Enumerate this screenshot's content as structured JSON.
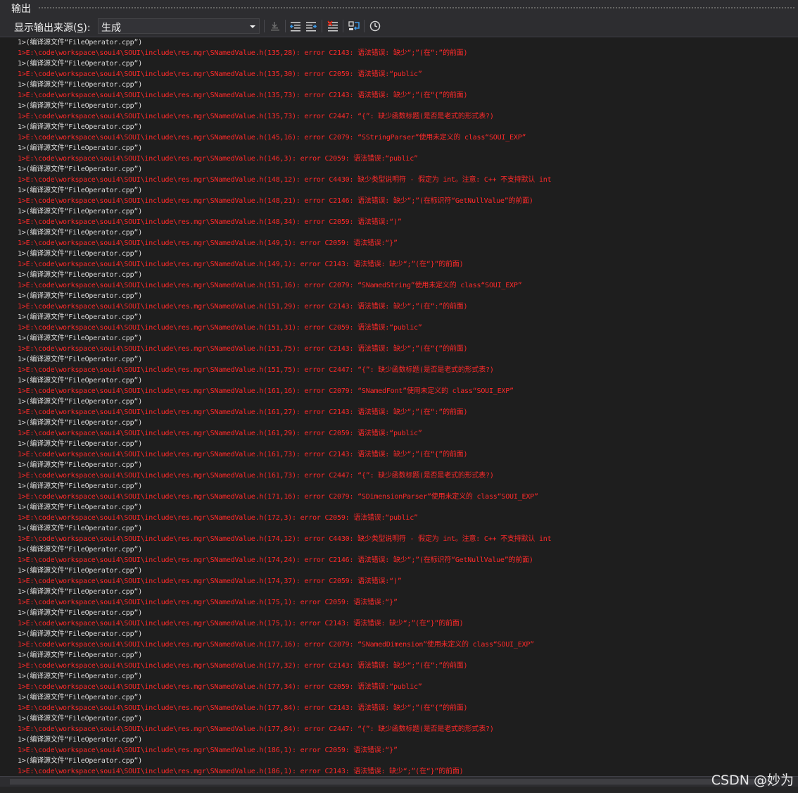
{
  "window": {
    "title": "输出"
  },
  "toolbar": {
    "source_label_prefix": "显示输出来源(",
    "source_label_key": "S",
    "source_label_suffix": "):",
    "source_value": "生成",
    "buttons": [
      {
        "name": "find-message-in-code-icon"
      },
      {
        "name": "go-to-previous-message-icon"
      },
      {
        "name": "go-to-next-message-icon"
      },
      {
        "name": "clear-all-icon"
      },
      {
        "name": "toggle-word-wrap-icon"
      },
      {
        "name": "toggle-timestamp-icon"
      }
    ]
  },
  "output": {
    "lines": [
      {
        "type": "info",
        "text": "1>(编译源文件“FileOperator.cpp”)"
      },
      {
        "type": "err",
        "text": "1>E:\\code\\workspace\\soui4\\SOUI\\include\\res.mgr\\SNamedValue.h(135,28): error C2143: 语法错误: 缺少“;”(在“:”的前面)"
      },
      {
        "type": "info",
        "text": "1>(编译源文件“FileOperator.cpp”)"
      },
      {
        "type": "err",
        "text": "1>E:\\code\\workspace\\soui4\\SOUI\\include\\res.mgr\\SNamedValue.h(135,30): error C2059: 语法错误:“public”"
      },
      {
        "type": "info",
        "text": "1>(编译源文件“FileOperator.cpp”)"
      },
      {
        "type": "err",
        "text": "1>E:\\code\\workspace\\soui4\\SOUI\\include\\res.mgr\\SNamedValue.h(135,73): error C2143: 语法错误: 缺少“;”(在“{”的前面)"
      },
      {
        "type": "info",
        "text": "1>(编译源文件“FileOperator.cpp”)"
      },
      {
        "type": "err",
        "text": "1>E:\\code\\workspace\\soui4\\SOUI\\include\\res.mgr\\SNamedValue.h(135,73): error C2447: “{”: 缺少函数标题(是否是老式的形式表?)"
      },
      {
        "type": "info",
        "text": "1>(编译源文件“FileOperator.cpp”)"
      },
      {
        "type": "err",
        "text": "1>E:\\code\\workspace\\soui4\\SOUI\\include\\res.mgr\\SNamedValue.h(145,16): error C2079: “SStringParser”使用未定义的 class“SOUI_EXP”"
      },
      {
        "type": "info",
        "text": "1>(编译源文件“FileOperator.cpp”)"
      },
      {
        "type": "err",
        "text": "1>E:\\code\\workspace\\soui4\\SOUI\\include\\res.mgr\\SNamedValue.h(146,3): error C2059: 语法错误:“public”"
      },
      {
        "type": "info",
        "text": "1>(编译源文件“FileOperator.cpp”)"
      },
      {
        "type": "err",
        "text": "1>E:\\code\\workspace\\soui4\\SOUI\\include\\res.mgr\\SNamedValue.h(148,12): error C4430: 缺少类型说明符 - 假定为 int。注意: C++ 不支持默认 int"
      },
      {
        "type": "info",
        "text": "1>(编译源文件“FileOperator.cpp”)"
      },
      {
        "type": "err",
        "text": "1>E:\\code\\workspace\\soui4\\SOUI\\include\\res.mgr\\SNamedValue.h(148,21): error C2146: 语法错误: 缺少“;”(在标识符“GetNullValue”的前面)"
      },
      {
        "type": "info",
        "text": "1>(编译源文件“FileOperator.cpp”)"
      },
      {
        "type": "err",
        "text": "1>E:\\code\\workspace\\soui4\\SOUI\\include\\res.mgr\\SNamedValue.h(148,34): error C2059: 语法错误:“)”"
      },
      {
        "type": "info",
        "text": "1>(编译源文件“FileOperator.cpp”)"
      },
      {
        "type": "err",
        "text": "1>E:\\code\\workspace\\soui4\\SOUI\\include\\res.mgr\\SNamedValue.h(149,1): error C2059: 语法错误:“}”"
      },
      {
        "type": "info",
        "text": "1>(编译源文件“FileOperator.cpp”)"
      },
      {
        "type": "err",
        "text": "1>E:\\code\\workspace\\soui4\\SOUI\\include\\res.mgr\\SNamedValue.h(149,1): error C2143: 语法错误: 缺少“;”(在“}”的前面)"
      },
      {
        "type": "info",
        "text": "1>(编译源文件“FileOperator.cpp”)"
      },
      {
        "type": "err",
        "text": "1>E:\\code\\workspace\\soui4\\SOUI\\include\\res.mgr\\SNamedValue.h(151,16): error C2079: “SNamedString”使用未定义的 class“SOUI_EXP”"
      },
      {
        "type": "info",
        "text": "1>(编译源文件“FileOperator.cpp”)"
      },
      {
        "type": "err",
        "text": "1>E:\\code\\workspace\\soui4\\SOUI\\include\\res.mgr\\SNamedValue.h(151,29): error C2143: 语法错误: 缺少“;”(在“:”的前面)"
      },
      {
        "type": "info",
        "text": "1>(编译源文件“FileOperator.cpp”)"
      },
      {
        "type": "err",
        "text": "1>E:\\code\\workspace\\soui4\\SOUI\\include\\res.mgr\\SNamedValue.h(151,31): error C2059: 语法错误:“public”"
      },
      {
        "type": "info",
        "text": "1>(编译源文件“FileOperator.cpp”)"
      },
      {
        "type": "err",
        "text": "1>E:\\code\\workspace\\soui4\\SOUI\\include\\res.mgr\\SNamedValue.h(151,75): error C2143: 语法错误: 缺少“;”(在“{”的前面)"
      },
      {
        "type": "info",
        "text": "1>(编译源文件“FileOperator.cpp”)"
      },
      {
        "type": "err",
        "text": "1>E:\\code\\workspace\\soui4\\SOUI\\include\\res.mgr\\SNamedValue.h(151,75): error C2447: “{”: 缺少函数标题(是否是老式的形式表?)"
      },
      {
        "type": "info",
        "text": "1>(编译源文件“FileOperator.cpp”)"
      },
      {
        "type": "err",
        "text": "1>E:\\code\\workspace\\soui4\\SOUI\\include\\res.mgr\\SNamedValue.h(161,16): error C2079: “SNamedFont”使用未定义的 class“SOUI_EXP”"
      },
      {
        "type": "info",
        "text": "1>(编译源文件“FileOperator.cpp”)"
      },
      {
        "type": "err",
        "text": "1>E:\\code\\workspace\\soui4\\SOUI\\include\\res.mgr\\SNamedValue.h(161,27): error C2143: 语法错误: 缺少“;”(在“:”的前面)"
      },
      {
        "type": "info",
        "text": "1>(编译源文件“FileOperator.cpp”)"
      },
      {
        "type": "err",
        "text": "1>E:\\code\\workspace\\soui4\\SOUI\\include\\res.mgr\\SNamedValue.h(161,29): error C2059: 语法错误:“public”"
      },
      {
        "type": "info",
        "text": "1>(编译源文件“FileOperator.cpp”)"
      },
      {
        "type": "err",
        "text": "1>E:\\code\\workspace\\soui4\\SOUI\\include\\res.mgr\\SNamedValue.h(161,73): error C2143: 语法错误: 缺少“;”(在“{”的前面)"
      },
      {
        "type": "info",
        "text": "1>(编译源文件“FileOperator.cpp”)"
      },
      {
        "type": "err",
        "text": "1>E:\\code\\workspace\\soui4\\SOUI\\include\\res.mgr\\SNamedValue.h(161,73): error C2447: “{”: 缺少函数标题(是否是老式的形式表?)"
      },
      {
        "type": "info",
        "text": "1>(编译源文件“FileOperator.cpp”)"
      },
      {
        "type": "err",
        "text": "1>E:\\code\\workspace\\soui4\\SOUI\\include\\res.mgr\\SNamedValue.h(171,16): error C2079: “SDimensionParser”使用未定义的 class“SOUI_EXP”"
      },
      {
        "type": "info",
        "text": "1>(编译源文件“FileOperator.cpp”)"
      },
      {
        "type": "err",
        "text": "1>E:\\code\\workspace\\soui4\\SOUI\\include\\res.mgr\\SNamedValue.h(172,3): error C2059: 语法错误:“public”"
      },
      {
        "type": "info",
        "text": "1>(编译源文件“FileOperator.cpp”)"
      },
      {
        "type": "err",
        "text": "1>E:\\code\\workspace\\soui4\\SOUI\\include\\res.mgr\\SNamedValue.h(174,12): error C4430: 缺少类型说明符 - 假定为 int。注意: C++ 不支持默认 int"
      },
      {
        "type": "info",
        "text": "1>(编译源文件“FileOperator.cpp”)"
      },
      {
        "type": "err",
        "text": "1>E:\\code\\workspace\\soui4\\SOUI\\include\\res.mgr\\SNamedValue.h(174,24): error C2146: 语法错误: 缺少“;”(在标识符“GetNullValue”的前面)"
      },
      {
        "type": "info",
        "text": "1>(编译源文件“FileOperator.cpp”)"
      },
      {
        "type": "err",
        "text": "1>E:\\code\\workspace\\soui4\\SOUI\\include\\res.mgr\\SNamedValue.h(174,37): error C2059: 语法错误:“)”"
      },
      {
        "type": "info",
        "text": "1>(编译源文件“FileOperator.cpp”)"
      },
      {
        "type": "err",
        "text": "1>E:\\code\\workspace\\soui4\\SOUI\\include\\res.mgr\\SNamedValue.h(175,1): error C2059: 语法错误:“}”"
      },
      {
        "type": "info",
        "text": "1>(编译源文件“FileOperator.cpp”)"
      },
      {
        "type": "err",
        "text": "1>E:\\code\\workspace\\soui4\\SOUI\\include\\res.mgr\\SNamedValue.h(175,1): error C2143: 语法错误: 缺少“;”(在“}”的前面)"
      },
      {
        "type": "info",
        "text": "1>(编译源文件“FileOperator.cpp”)"
      },
      {
        "type": "err",
        "text": "1>E:\\code\\workspace\\soui4\\SOUI\\include\\res.mgr\\SNamedValue.h(177,16): error C2079: “SNamedDimension”使用未定义的 class“SOUI_EXP”"
      },
      {
        "type": "info",
        "text": "1>(编译源文件“FileOperator.cpp”)"
      },
      {
        "type": "err",
        "text": "1>E:\\code\\workspace\\soui4\\SOUI\\include\\res.mgr\\SNamedValue.h(177,32): error C2143: 语法错误: 缺少“;”(在“:”的前面)"
      },
      {
        "type": "info",
        "text": "1>(编译源文件“FileOperator.cpp”)"
      },
      {
        "type": "err",
        "text": "1>E:\\code\\workspace\\soui4\\SOUI\\include\\res.mgr\\SNamedValue.h(177,34): error C2059: 语法错误:“public”"
      },
      {
        "type": "info",
        "text": "1>(编译源文件“FileOperator.cpp”)"
      },
      {
        "type": "err",
        "text": "1>E:\\code\\workspace\\soui4\\SOUI\\include\\res.mgr\\SNamedValue.h(177,84): error C2143: 语法错误: 缺少“;”(在“{”的前面)"
      },
      {
        "type": "info",
        "text": "1>(编译源文件“FileOperator.cpp”)"
      },
      {
        "type": "err",
        "text": "1>E:\\code\\workspace\\soui4\\SOUI\\include\\res.mgr\\SNamedValue.h(177,84): error C2447: “{”: 缺少函数标题(是否是老式的形式表?)"
      },
      {
        "type": "info",
        "text": "1>(编译源文件“FileOperator.cpp”)"
      },
      {
        "type": "err",
        "text": "1>E:\\code\\workspace\\soui4\\SOUI\\include\\res.mgr\\SNamedValue.h(186,1): error C2059: 语法错误:“}”"
      },
      {
        "type": "info",
        "text": "1>(编译源文件“FileOperator.cpp”)"
      },
      {
        "type": "err",
        "text": "1>E:\\code\\workspace\\soui4\\SOUI\\include\\res.mgr\\SNamedValue.h(186,1): error C2143: 语法错误: 缺少“;”(在“}”的前面)"
      }
    ]
  },
  "watermark": "CSDN @妙为",
  "colors": {
    "background": "#1e1e1e",
    "info_text": "#dcdcdc",
    "error_text": "#ff2a2a",
    "panel": "#2d2d30"
  }
}
